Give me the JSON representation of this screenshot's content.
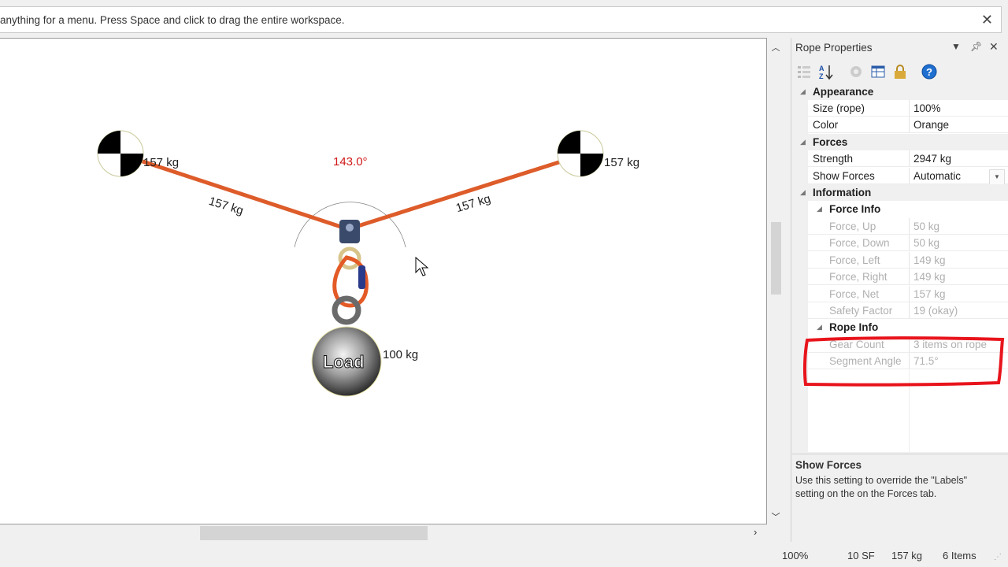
{
  "hint": {
    "text": "anything for a menu. Press Space and click to drag the entire workspace.",
    "close_icon": "close-icon"
  },
  "diagram": {
    "angle_label": "143.0°",
    "anchor_left_force": "157 kg",
    "anchor_right_force": "157 kg",
    "rope_left_force": "157 kg",
    "rope_right_force": "157 kg",
    "load_label": "Load",
    "load_weight": "100 kg",
    "rope_color": "#dd5c2a",
    "angle_color": "#d01818"
  },
  "panel": {
    "title": "Rope Properties",
    "toolbar": [
      "categorized-icon",
      "alphabetical-icon",
      "events-icon",
      "property-pages-icon",
      "lock-icon",
      "help-icon"
    ],
    "sections": {
      "appearance": {
        "label": "Appearance",
        "size_label": "Size (rope)",
        "size_value": "100%",
        "color_label": "Color",
        "color_value": "Orange"
      },
      "forces": {
        "label": "Forces",
        "strength_label": "Strength",
        "strength_value": "2947 kg",
        "show_forces_label": "Show Forces",
        "show_forces_value": "Automatic"
      },
      "information": {
        "label": "Information",
        "force_info": {
          "label": "Force Info",
          "up_label": "Force, Up",
          "up_value": "50 kg",
          "down_label": "Force, Down",
          "down_value": "50 kg",
          "left_label": "Force, Left",
          "left_value": "149 kg",
          "right_label": "Force, Right",
          "right_value": "149 kg",
          "net_label": "Force, Net",
          "net_value": "157 kg",
          "safety_label": "Safety Factor",
          "safety_value": "19 (okay)"
        },
        "rope_info": {
          "label": "Rope Info",
          "gear_label": "Gear Count",
          "gear_value": "3 items on rope",
          "angle_label": "Segment Angle",
          "angle_value": "71.5°"
        }
      }
    },
    "description": {
      "title": "Show Forces",
      "text": "Use this setting to override the \"Labels\" setting on the on the Forces tab."
    },
    "highlight_color": "#e8141c"
  },
  "status": {
    "zoom": "100%",
    "safety": "10 SF",
    "force": "157 kg",
    "items": "6 Items"
  }
}
